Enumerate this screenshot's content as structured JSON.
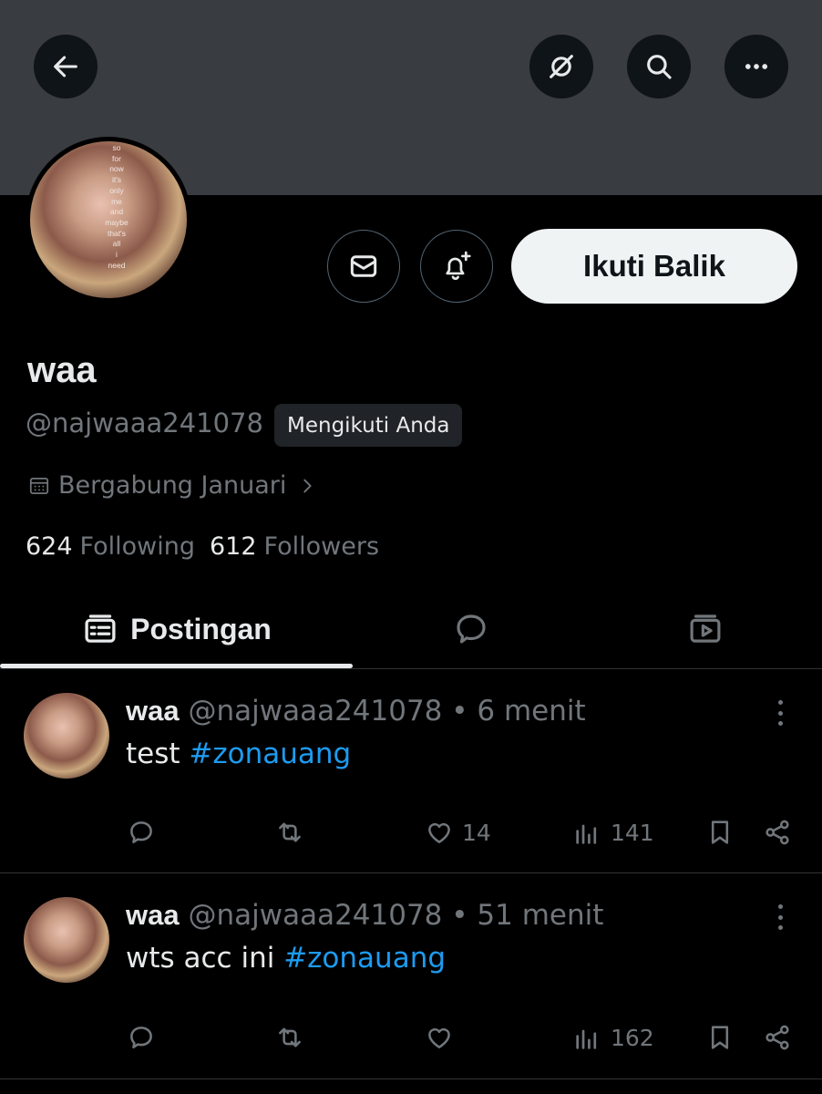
{
  "header": {
    "back_icon": "arrow-left-icon",
    "grok_icon": "grok-icon",
    "search_icon": "search-icon",
    "more_icon": "more-horizontal-icon"
  },
  "profile": {
    "avatar_caption": [
      "so",
      "for",
      "now",
      "it's",
      "only",
      "me",
      "and",
      "maybe",
      "that's",
      "all",
      "i",
      "need"
    ],
    "name": "waa",
    "handle": "@najwaaa241078",
    "follows_you_badge": "Mengikuti Anda",
    "joined": "Bergabung Januari",
    "following_count": "624",
    "following_label": "Following",
    "followers_count": "612",
    "followers_label": "Followers",
    "follow_back_label": "Ikuti Balik"
  },
  "tabs": [
    {
      "label": "Postingan",
      "icon": "posts-icon",
      "active": true
    },
    {
      "label": "",
      "icon": "replies-icon",
      "active": false
    },
    {
      "label": "",
      "icon": "media-icon",
      "active": false
    }
  ],
  "posts": [
    {
      "name": "waa",
      "meta": "@najwaaa241078 • 6 menit",
      "text": "test ",
      "hashtag": "#zonauang",
      "likes": "14",
      "views": "141"
    },
    {
      "name": "waa",
      "meta": "@najwaaa241078 • 51 menit",
      "text": "wts acc ini ",
      "hashtag": "#zonauang",
      "likes": "",
      "views": "162"
    }
  ],
  "colors": {
    "background": "#000000",
    "banner": "#393c40",
    "accent_link": "#1d9bf0",
    "muted_text": "#71767b",
    "primary_text": "#e7e9ea"
  }
}
